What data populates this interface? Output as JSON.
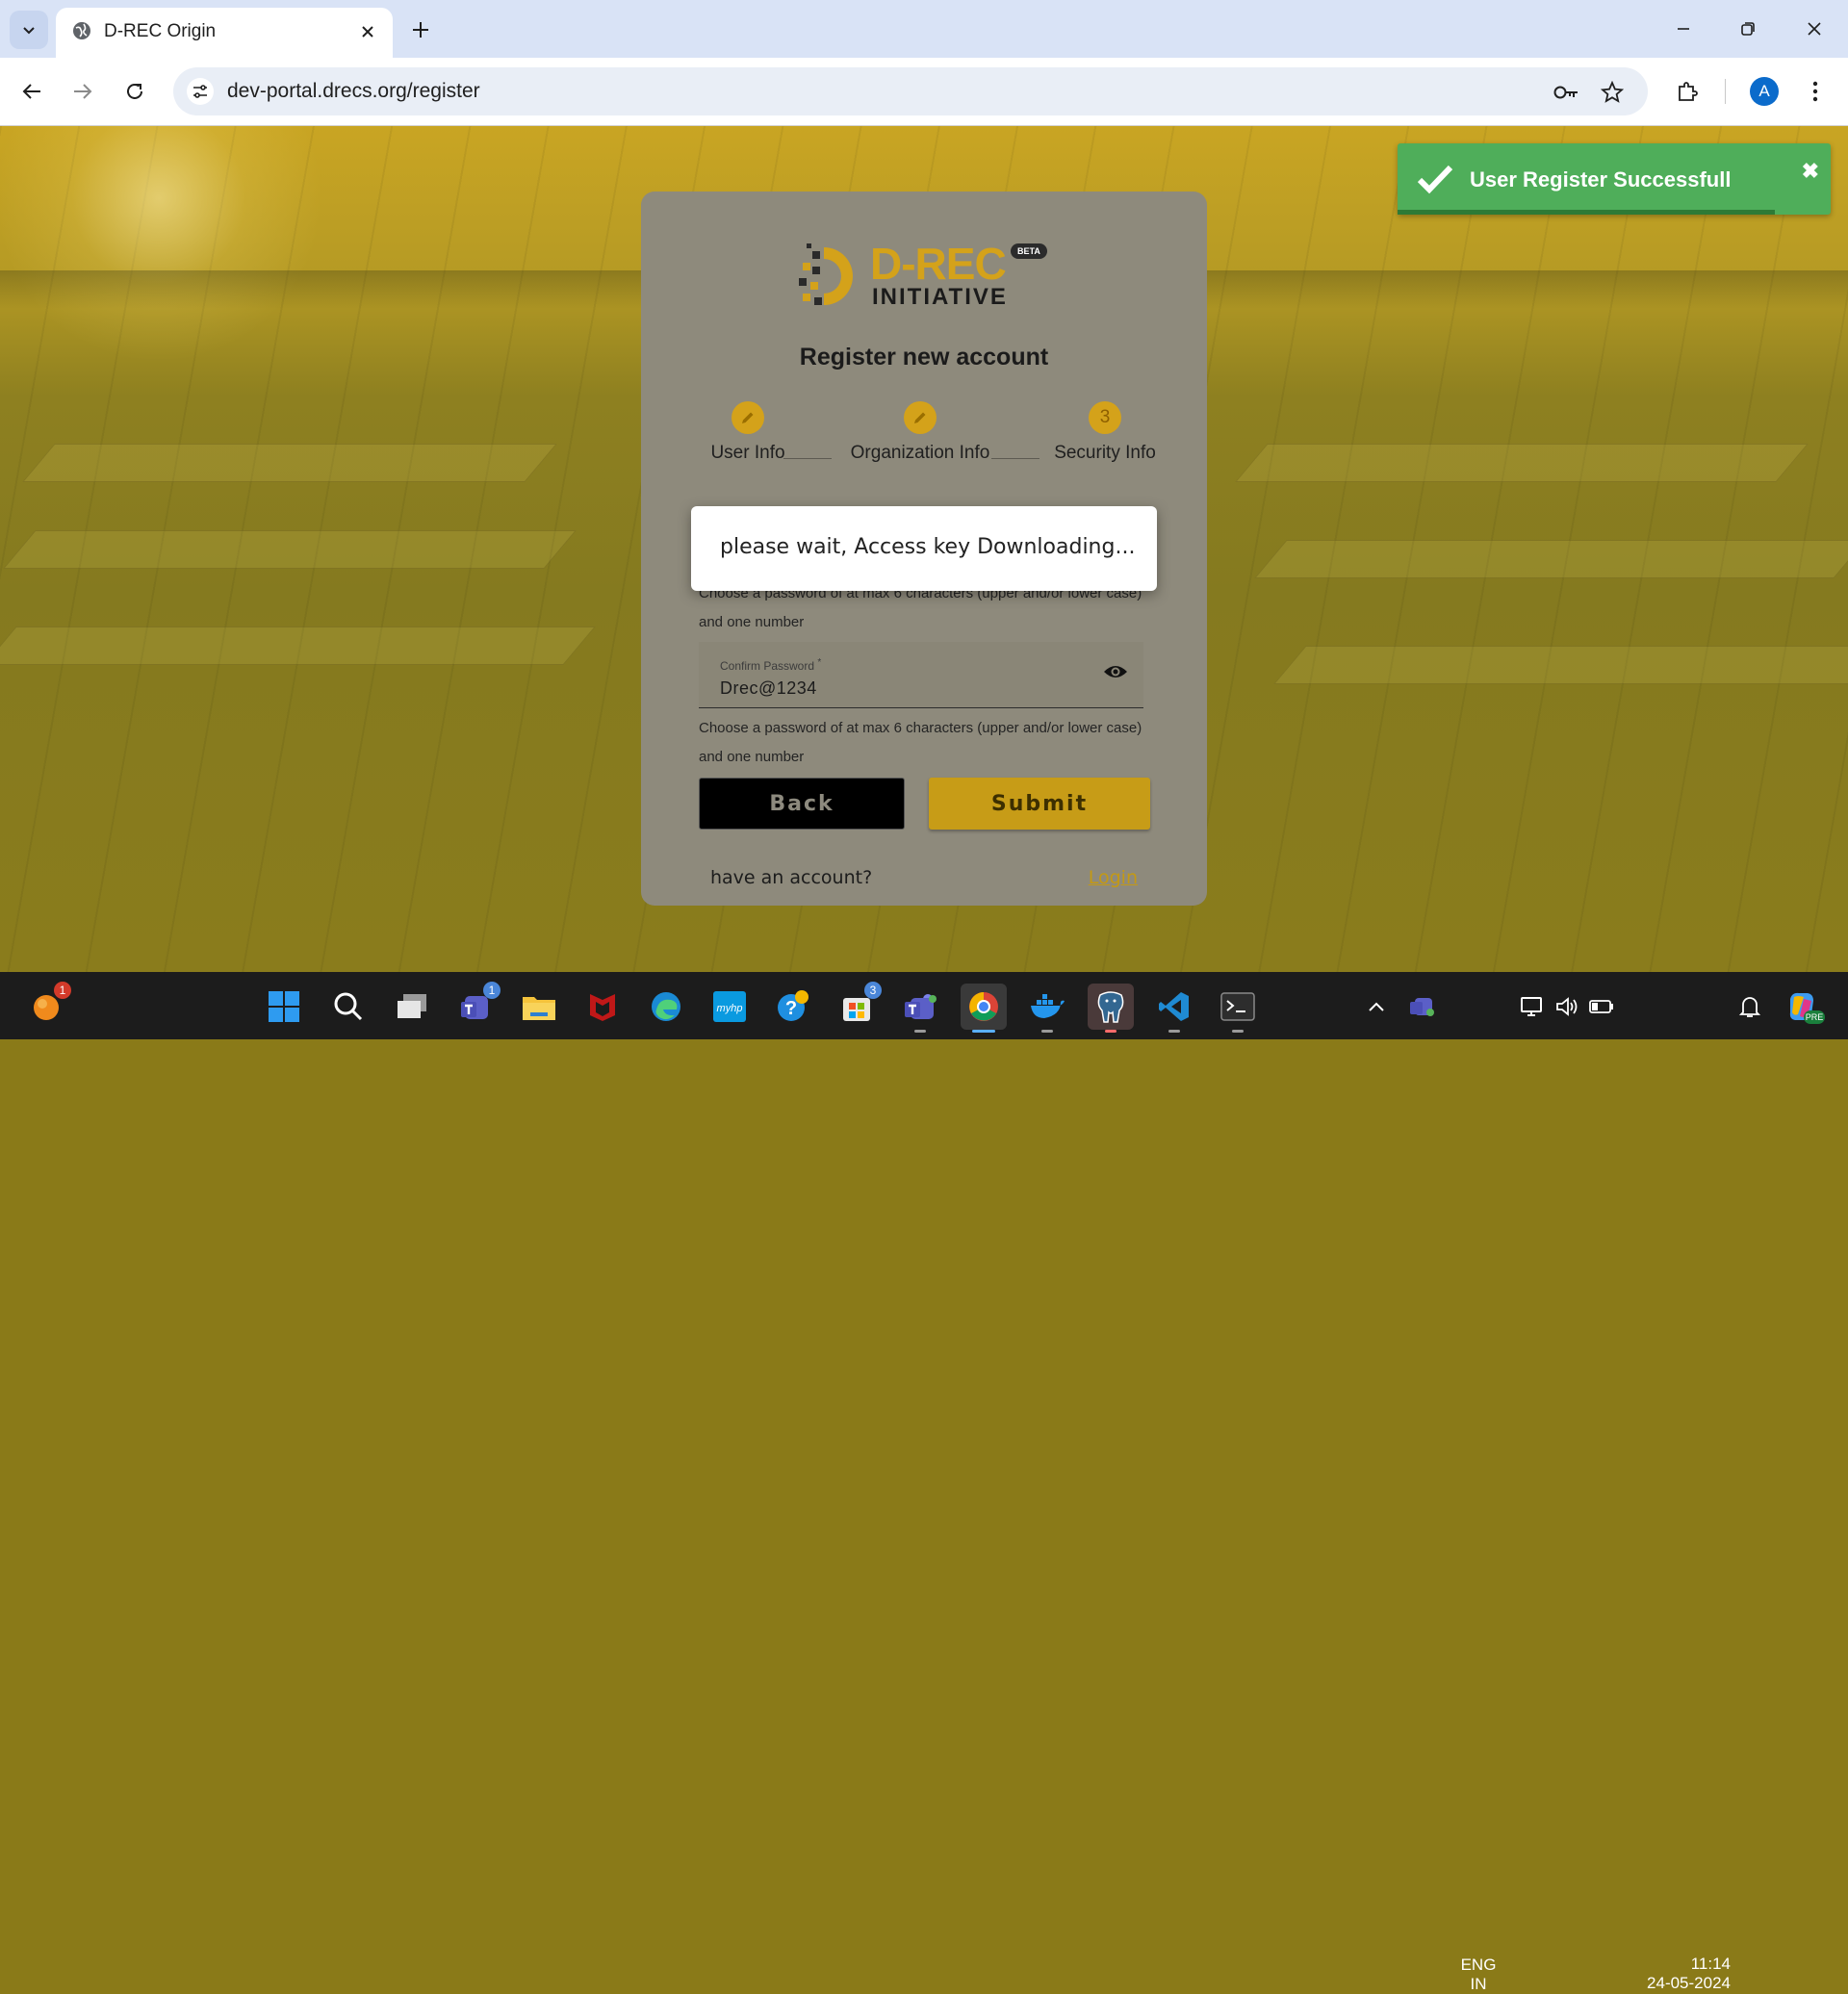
{
  "browser": {
    "tab_title": "D-REC Origin",
    "url": "dev-portal.drecs.org/register",
    "profile_initial": "A"
  },
  "logo": {
    "line1": "D-REC",
    "line2": "INITIATIVE",
    "badge": "BETA"
  },
  "card": {
    "title": "Register new account",
    "steps": [
      {
        "label": "User Info",
        "icon": "pencil-icon",
        "state": "completed"
      },
      {
        "label": "Organization Info",
        "icon": "pencil-icon",
        "state": "completed"
      },
      {
        "label": "Security Info",
        "number": "3",
        "state": "active"
      }
    ],
    "password_hint_partial": "Choose a password of at max 6 characters (upper and/or lower case) and one number",
    "confirm_password": {
      "label": "Confirm Password",
      "required_mark": "*",
      "value": "Drec@1234"
    },
    "confirm_hint": "Choose a password of at max 6 characters (upper and/or lower case) and one number",
    "back_label": "Back",
    "submit_label": "Submit",
    "have_account_text": "have an account?",
    "login_link": "Login"
  },
  "modal": {
    "message": "please wait, Access key Downloading..."
  },
  "toast": {
    "message": "User Register Successfull",
    "close": "✖",
    "progress": 0.87
  },
  "taskbar": {
    "apps": [
      {
        "name": "start",
        "icon": "windows-start-icon"
      },
      {
        "name": "search",
        "icon": "search-icon"
      },
      {
        "name": "task-view",
        "icon": "task-view-icon"
      },
      {
        "name": "teams-chat",
        "icon": "teams-icon",
        "badge": "1"
      },
      {
        "name": "file-explorer",
        "icon": "folder-icon"
      },
      {
        "name": "mcafee",
        "icon": "mcafee-icon"
      },
      {
        "name": "edge",
        "icon": "edge-icon"
      },
      {
        "name": "myhp",
        "icon": "myhp-icon",
        "text": "myhp"
      },
      {
        "name": "help",
        "icon": "help-icon"
      },
      {
        "name": "store",
        "icon": "store-icon",
        "badge": "3"
      },
      {
        "name": "teams",
        "icon": "teams-icon"
      },
      {
        "name": "chrome",
        "icon": "chrome-icon"
      },
      {
        "name": "docker",
        "icon": "docker-icon"
      },
      {
        "name": "pgadmin",
        "icon": "postgres-icon"
      },
      {
        "name": "vscode",
        "icon": "vscode-icon"
      },
      {
        "name": "terminal",
        "icon": "terminal-icon"
      }
    ],
    "notification_badge": "1",
    "lang_line1": "ENG",
    "lang_line2": "IN",
    "time": "11:14",
    "date": "24-05-2024",
    "copilot_badge": "PRE"
  },
  "colors": {
    "accent_gold": "#d4a21a",
    "toast_green": "#4fae5a",
    "taskbar": "#1c1c1c"
  }
}
